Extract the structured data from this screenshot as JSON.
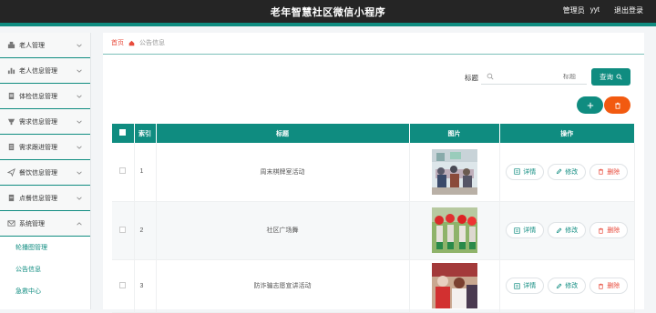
{
  "header": {
    "title": "老年智慧社区微信小程序",
    "role": "管理员",
    "username": "yyt",
    "logout": "退出登录"
  },
  "sidebar": {
    "items": [
      {
        "label": "老人管理",
        "icon": "user-icon"
      },
      {
        "label": "老人信息管理",
        "icon": "chart-icon"
      },
      {
        "label": "体检信息管理",
        "icon": "clipboard-icon"
      },
      {
        "label": "需求信息管理",
        "icon": "cup-icon"
      },
      {
        "label": "需求跟进管理",
        "icon": "list-icon"
      },
      {
        "label": "餐饮信息管理",
        "icon": "send-icon"
      },
      {
        "label": "点餐信息管理",
        "icon": "doc-icon"
      },
      {
        "label": "系统管理",
        "icon": "mail-icon"
      }
    ],
    "submenu": [
      {
        "label": "轮播图管理"
      },
      {
        "label": "公告信息"
      },
      {
        "label": "急救中心"
      }
    ]
  },
  "breadcrumb": {
    "home": "首页",
    "current": "公告信息"
  },
  "search": {
    "label": "标题",
    "placeholder": "标题",
    "query_button": "查询"
  },
  "table": {
    "headers": [
      "索引",
      "标题",
      "图片",
      "操作"
    ],
    "rows": [
      {
        "index": "1",
        "title": "周末棋牌室活动",
        "image": "photo-chess-room"
      },
      {
        "index": "2",
        "title": "社区广场舞",
        "image": "photo-square-dance"
      },
      {
        "index": "3",
        "title": "防诈骗志愿宣讲活动",
        "image": "photo-volunteer-talk"
      }
    ],
    "actions": {
      "detail": "详情",
      "edit": "修改",
      "delete": "删除"
    }
  },
  "colors": {
    "accent": "#0f8c80",
    "danger": "#f25a10",
    "topbar": "#252525"
  }
}
